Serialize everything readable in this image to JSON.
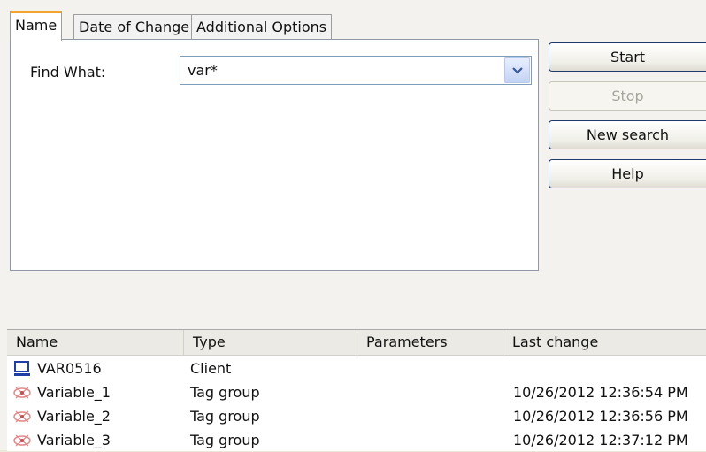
{
  "tabs": [
    {
      "label": "Name"
    },
    {
      "label": "Date of Change"
    },
    {
      "label": "Additional Options"
    }
  ],
  "find": {
    "label": "Find What:",
    "value": "var*"
  },
  "buttons": {
    "start": "Start",
    "stop": "Stop",
    "new_search": "New search",
    "help": "Help"
  },
  "results": {
    "columns": [
      "Name",
      "Type",
      "Parameters",
      "Last change"
    ],
    "rows": [
      {
        "icon": "client-monitor-icon",
        "name": "VAR0516",
        "type": "Client",
        "parameters": "",
        "last_change": ""
      },
      {
        "icon": "tag-group-icon",
        "name": "Variable_1",
        "type": "Tag group",
        "parameters": "",
        "last_change": "10/26/2012 12:36:54 PM"
      },
      {
        "icon": "tag-group-icon",
        "name": "Variable_2",
        "type": "Tag group",
        "parameters": "",
        "last_change": "10/26/2012 12:36:56 PM"
      },
      {
        "icon": "tag-group-icon",
        "name": "Variable_3",
        "type": "Tag group",
        "parameters": "",
        "last_change": "10/26/2012 12:37:12 PM"
      }
    ]
  }
}
